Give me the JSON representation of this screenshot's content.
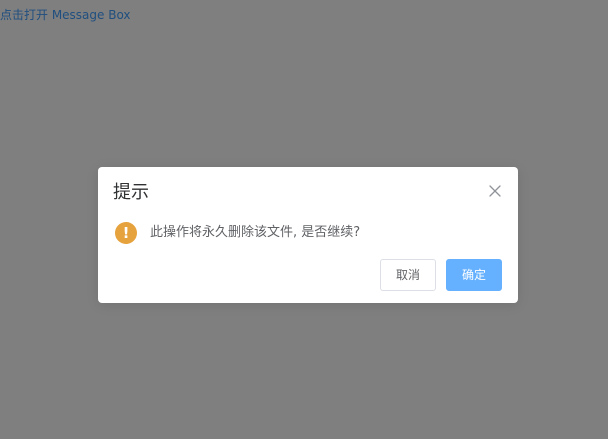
{
  "page": {
    "open_link_label": "点击打开 Message Box"
  },
  "dialog": {
    "title": "提示",
    "close_icon": "close-icon",
    "status_icon": "warning-icon",
    "status_symbol": "!",
    "message": "此操作将永久删除该文件, 是否继续?",
    "cancel_label": "取消",
    "confirm_label": "确定"
  },
  "colors": {
    "link": "#409eff",
    "warning": "#e6a23c",
    "primary_button": "#66b1ff",
    "overlay": "rgba(0,0,0,0.5)"
  }
}
